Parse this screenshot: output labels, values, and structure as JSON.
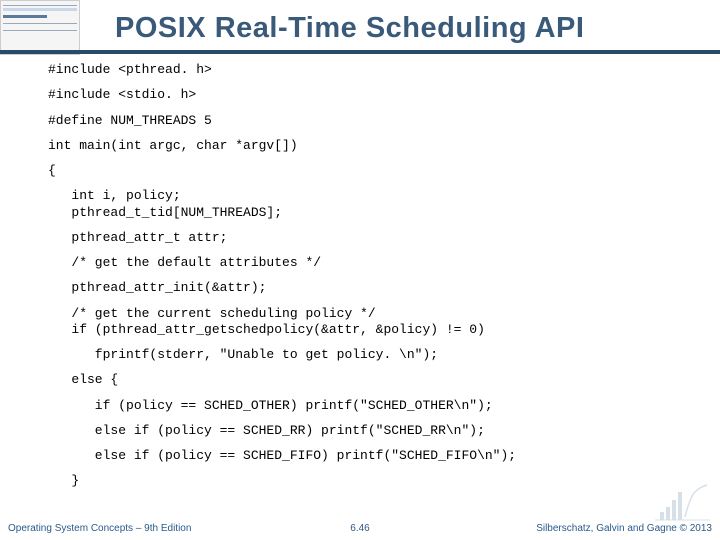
{
  "title": "POSIX Real-Time Scheduling API",
  "code": {
    "l1": "#include <pthread. h>",
    "l2": "#include <stdio. h>",
    "l3": "#define NUM_THREADS 5",
    "l4": "int main(int argc, char *argv[])",
    "l5": "{",
    "l6": "   int i, policy;\n   pthread_t_tid[NUM_THREADS];",
    "l7": "   pthread_attr_t attr;",
    "l8": "   /* get the default attributes */",
    "l9": "   pthread_attr_init(&attr);",
    "l10": "   /* get the current scheduling policy */\n   if (pthread_attr_getschedpolicy(&attr, &policy) != 0)",
    "l11": "      fprintf(stderr, \"Unable to get policy. \\n\");",
    "l12": "   else {",
    "l13": "      if (policy == SCHED_OTHER) printf(\"SCHED_OTHER\\n\");",
    "l14": "      else if (policy == SCHED_RR) printf(\"SCHED_RR\\n\");",
    "l15": "      else if (policy == SCHED_FIFO) printf(\"SCHED_FIFO\\n\");",
    "l16": "   }"
  },
  "footer": {
    "left": "Operating System Concepts – 9th Edition",
    "center": "6.46",
    "right": "Silberschatz, Galvin and Gagne © 2013"
  }
}
